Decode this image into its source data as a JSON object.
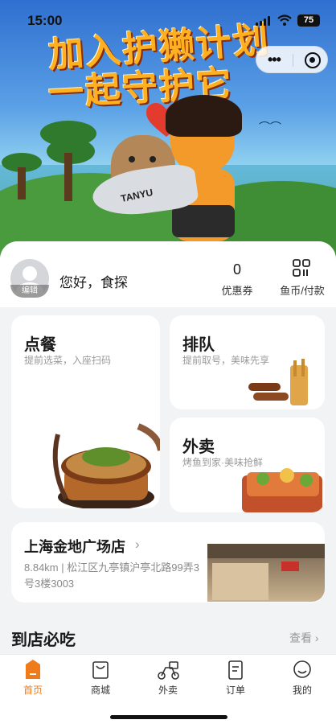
{
  "status_bar": {
    "time": "15:00",
    "battery": "75"
  },
  "banner": {
    "line1": "加入护獭计划",
    "line2": "一起守护它",
    "fish_text": "TANYU"
  },
  "user": {
    "avatar_edit": "编辑",
    "greeting": "您好，食探",
    "coupon_count": "0",
    "coupon_label": "优惠券",
    "pay_label": "鱼币/付款"
  },
  "cards": {
    "order": {
      "title": "点餐",
      "subtitle": "提前选菜，入座扫码"
    },
    "queue": {
      "title": "排队",
      "subtitle": "提前取号，美味先享"
    },
    "delivery": {
      "title": "外卖",
      "subtitle": "烤鱼到家·美味抢鲜"
    }
  },
  "store": {
    "name": "上海金地广场店",
    "address": "8.84km | 松江区九亭镇沪亭北路99弄3号3楼3003"
  },
  "section": {
    "title": "到店必吃",
    "more": "查看"
  },
  "tabbar": {
    "items": [
      {
        "label": "首页",
        "icon": "home-icon",
        "active": true
      },
      {
        "label": "商城",
        "icon": "shop-icon",
        "active": false
      },
      {
        "label": "外卖",
        "icon": "scooter-icon",
        "active": false
      },
      {
        "label": "订单",
        "icon": "order-icon",
        "active": false
      },
      {
        "label": "我的",
        "icon": "smile-icon",
        "active": false
      }
    ]
  },
  "colors": {
    "accent": "#f07b1b"
  }
}
